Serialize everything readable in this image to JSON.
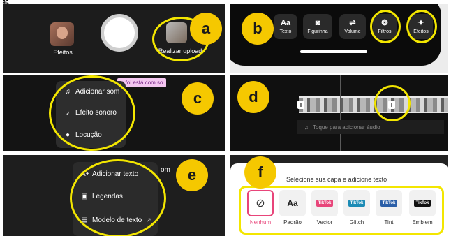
{
  "figure": {
    "heading": "g"
  },
  "panels": {
    "a": {
      "badge": "a",
      "effects_label": "Efeitos",
      "upload_label": "Realizar upload"
    },
    "b": {
      "badge": "b",
      "tools": [
        {
          "label": "Texto",
          "icon": "Aa"
        },
        {
          "label": "Figurinha",
          "icon": "sticker-icon"
        },
        {
          "label": "Volume",
          "icon": "volume-sliders-icon"
        },
        {
          "label": "Filtros",
          "icon": "filters-icon"
        },
        {
          "label": "Efeitos",
          "icon": "sparkle-icon"
        }
      ]
    },
    "c": {
      "badge": "c",
      "caption_fragment": "a foi está com so",
      "menu": [
        {
          "label": "Adicionar som",
          "icon": "music-note-icon"
        },
        {
          "label": "Efeito sonoro",
          "icon": "sound-effect-icon"
        },
        {
          "label": "Locução",
          "icon": "microphone-icon"
        }
      ]
    },
    "d": {
      "badge": "d",
      "audio_hint": "Toque para adicionar áudio"
    },
    "e": {
      "badge": "e",
      "caption_fragment": "om",
      "menu": [
        {
          "label": "Adicionar texto",
          "icon": "add-text-icon"
        },
        {
          "label": "Legendas",
          "icon": "captions-icon"
        },
        {
          "label": "Modelo de texto",
          "icon": "text-template-icon"
        }
      ]
    },
    "f": {
      "badge": "f",
      "title": "Selecione sua capa e adicione texto",
      "styles": [
        {
          "label": "Nenhum",
          "selected": true
        },
        {
          "label": "Padrão",
          "preview": "Aa"
        },
        {
          "label": "Vector",
          "preview": "TikTok"
        },
        {
          "label": "Glitch",
          "preview": "TikTok"
        },
        {
          "label": "Tint",
          "preview": "TikTok"
        },
        {
          "label": "Emblem",
          "preview": "TikTok"
        }
      ]
    }
  },
  "colors": {
    "badge": "#f5c800",
    "highlight": "#f3e600",
    "selected": "#e8457a"
  }
}
